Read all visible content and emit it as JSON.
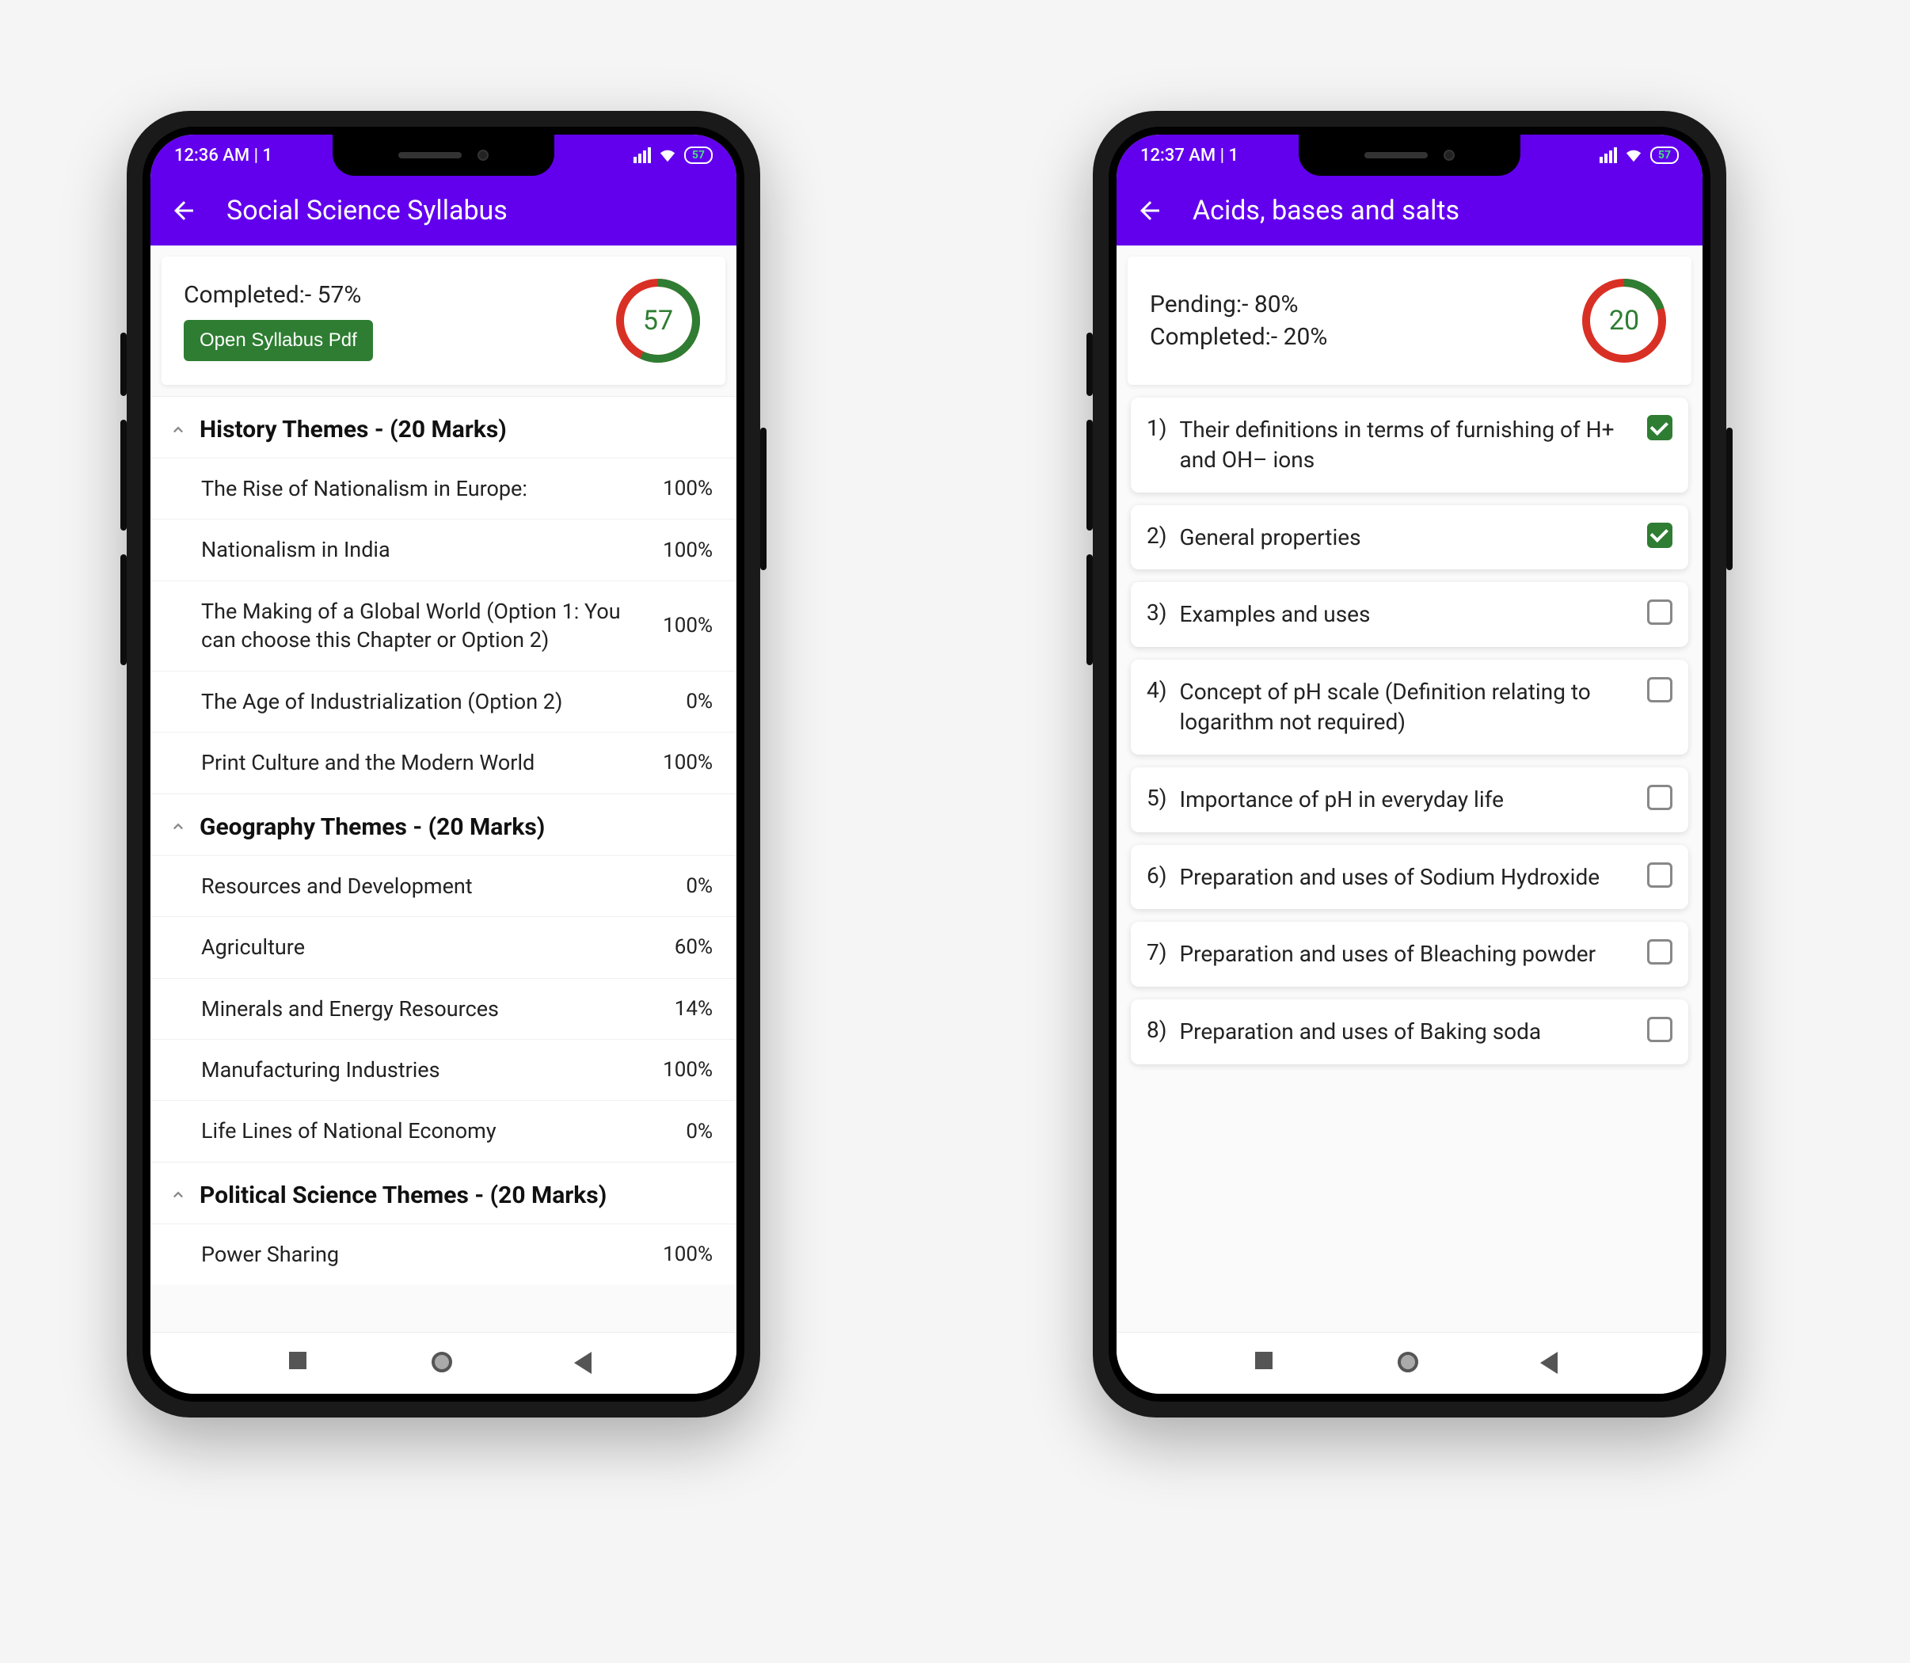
{
  "status_battery": "57",
  "left": {
    "status_time": "12:36 AM | 1",
    "app_title": "Social Science Syllabus",
    "completed_label": "Completed:- 57%",
    "open_pdf_label": "Open Syllabus Pdf",
    "ring_value": "57",
    "ring_pct": 57,
    "sections": [
      {
        "title": "History Themes - (20 Marks)",
        "topics": [
          {
            "name": "The Rise of Nationalism in Europe:",
            "pct": "100%"
          },
          {
            "name": "Nationalism in India",
            "pct": "100%"
          },
          {
            "name": "The Making of a Global World (Option 1: You can choose this Chapter or Option 2)",
            "pct": "100%"
          },
          {
            "name": "The Age of Industrialization (Option 2)",
            "pct": "0%"
          },
          {
            "name": "Print Culture and the Modern World",
            "pct": "100%"
          }
        ]
      },
      {
        "title": "Geography Themes - (20 Marks)",
        "topics": [
          {
            "name": "Resources and Development",
            "pct": "0%"
          },
          {
            "name": "Agriculture",
            "pct": "60%"
          },
          {
            "name": "Minerals and Energy Resources",
            "pct": "14%"
          },
          {
            "name": "Manufacturing Industries",
            "pct": "100%"
          },
          {
            "name": "Life Lines of National Economy",
            "pct": "0%"
          }
        ]
      },
      {
        "title": "Political Science Themes - (20 Marks)",
        "topics": [
          {
            "name": "Power Sharing",
            "pct": "100%"
          }
        ]
      }
    ]
  },
  "right": {
    "status_time": "12:37 AM | 1",
    "app_title": "Acids, bases and salts",
    "pending_label": "Pending:- 80%",
    "completed_label": "Completed:- 20%",
    "ring_value": "20",
    "ring_pct": 20,
    "tasks": [
      {
        "num": "1)",
        "text": "Their definitions in terms of furnishing of H+ and OH– ions",
        "checked": true
      },
      {
        "num": "2)",
        "text": "General properties",
        "checked": true
      },
      {
        "num": "3)",
        "text": "Examples and uses",
        "checked": false
      },
      {
        "num": "4)",
        "text": "Concept of pH scale (Definition relating to logarithm not required)",
        "checked": false
      },
      {
        "num": "5)",
        "text": "Importance of pH in everyday life",
        "checked": false
      },
      {
        "num": "6)",
        "text": "Preparation and uses of Sodium Hydroxide",
        "checked": false
      },
      {
        "num": "7)",
        "text": "Preparation and uses of Bleaching powder",
        "checked": false
      },
      {
        "num": "8)",
        "text": "Preparation and uses of Baking soda",
        "checked": false
      }
    ]
  }
}
